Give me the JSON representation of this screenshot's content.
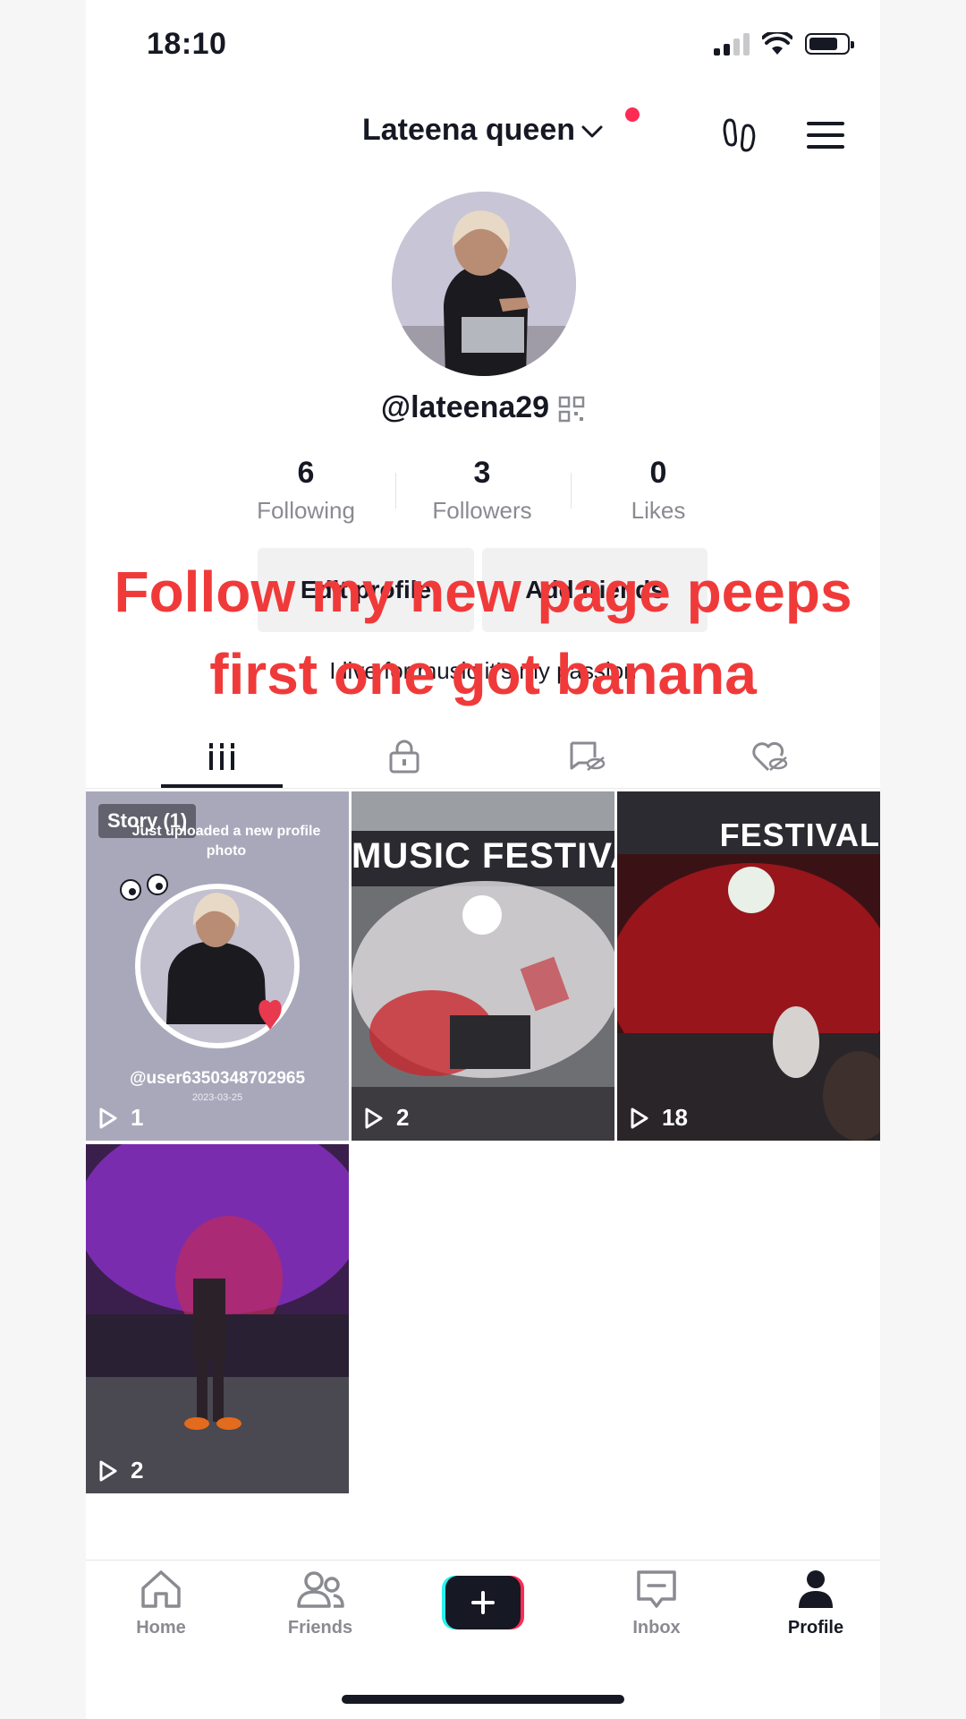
{
  "status_bar": {
    "time": "18:10"
  },
  "header": {
    "account_name": "Lateena queen"
  },
  "profile": {
    "username": "@lateena29",
    "bio": "I live for music it’s my passion",
    "stats": [
      {
        "value": "6",
        "label": "Following"
      },
      {
        "value": "3",
        "label": "Followers"
      },
      {
        "value": "0",
        "label": "Likes"
      }
    ],
    "edit_profile_label": "Edit profile",
    "add_friends_label": "Add friends"
  },
  "overlay_caption": {
    "line1": "Follow my new page peeps",
    "line2": "first one got banana"
  },
  "tabs": [
    {
      "icon": "grid-icon",
      "active": true
    },
    {
      "icon": "lock-icon"
    },
    {
      "icon": "hidden-posts-icon"
    },
    {
      "icon": "liked-hidden-icon"
    }
  ],
  "videos": [
    {
      "badge": "Story (1)",
      "views": "1",
      "story_text": "Just uploaded a new profile photo",
      "story_handle": "@user6350348702965",
      "story_date": "2023-03-25"
    },
    {
      "views": "2",
      "banner": "MUSIC FESTIVAL"
    },
    {
      "views": "18",
      "banner": "FESTIVAL"
    },
    {
      "views": "2"
    }
  ],
  "bottom_nav": {
    "home": "Home",
    "friends": "Friends",
    "inbox": "Inbox",
    "profile": "Profile"
  },
  "colors": {
    "accent": "#fe2c55",
    "overlay_text": "#f03a3a",
    "cyan": "#25f4ee"
  }
}
